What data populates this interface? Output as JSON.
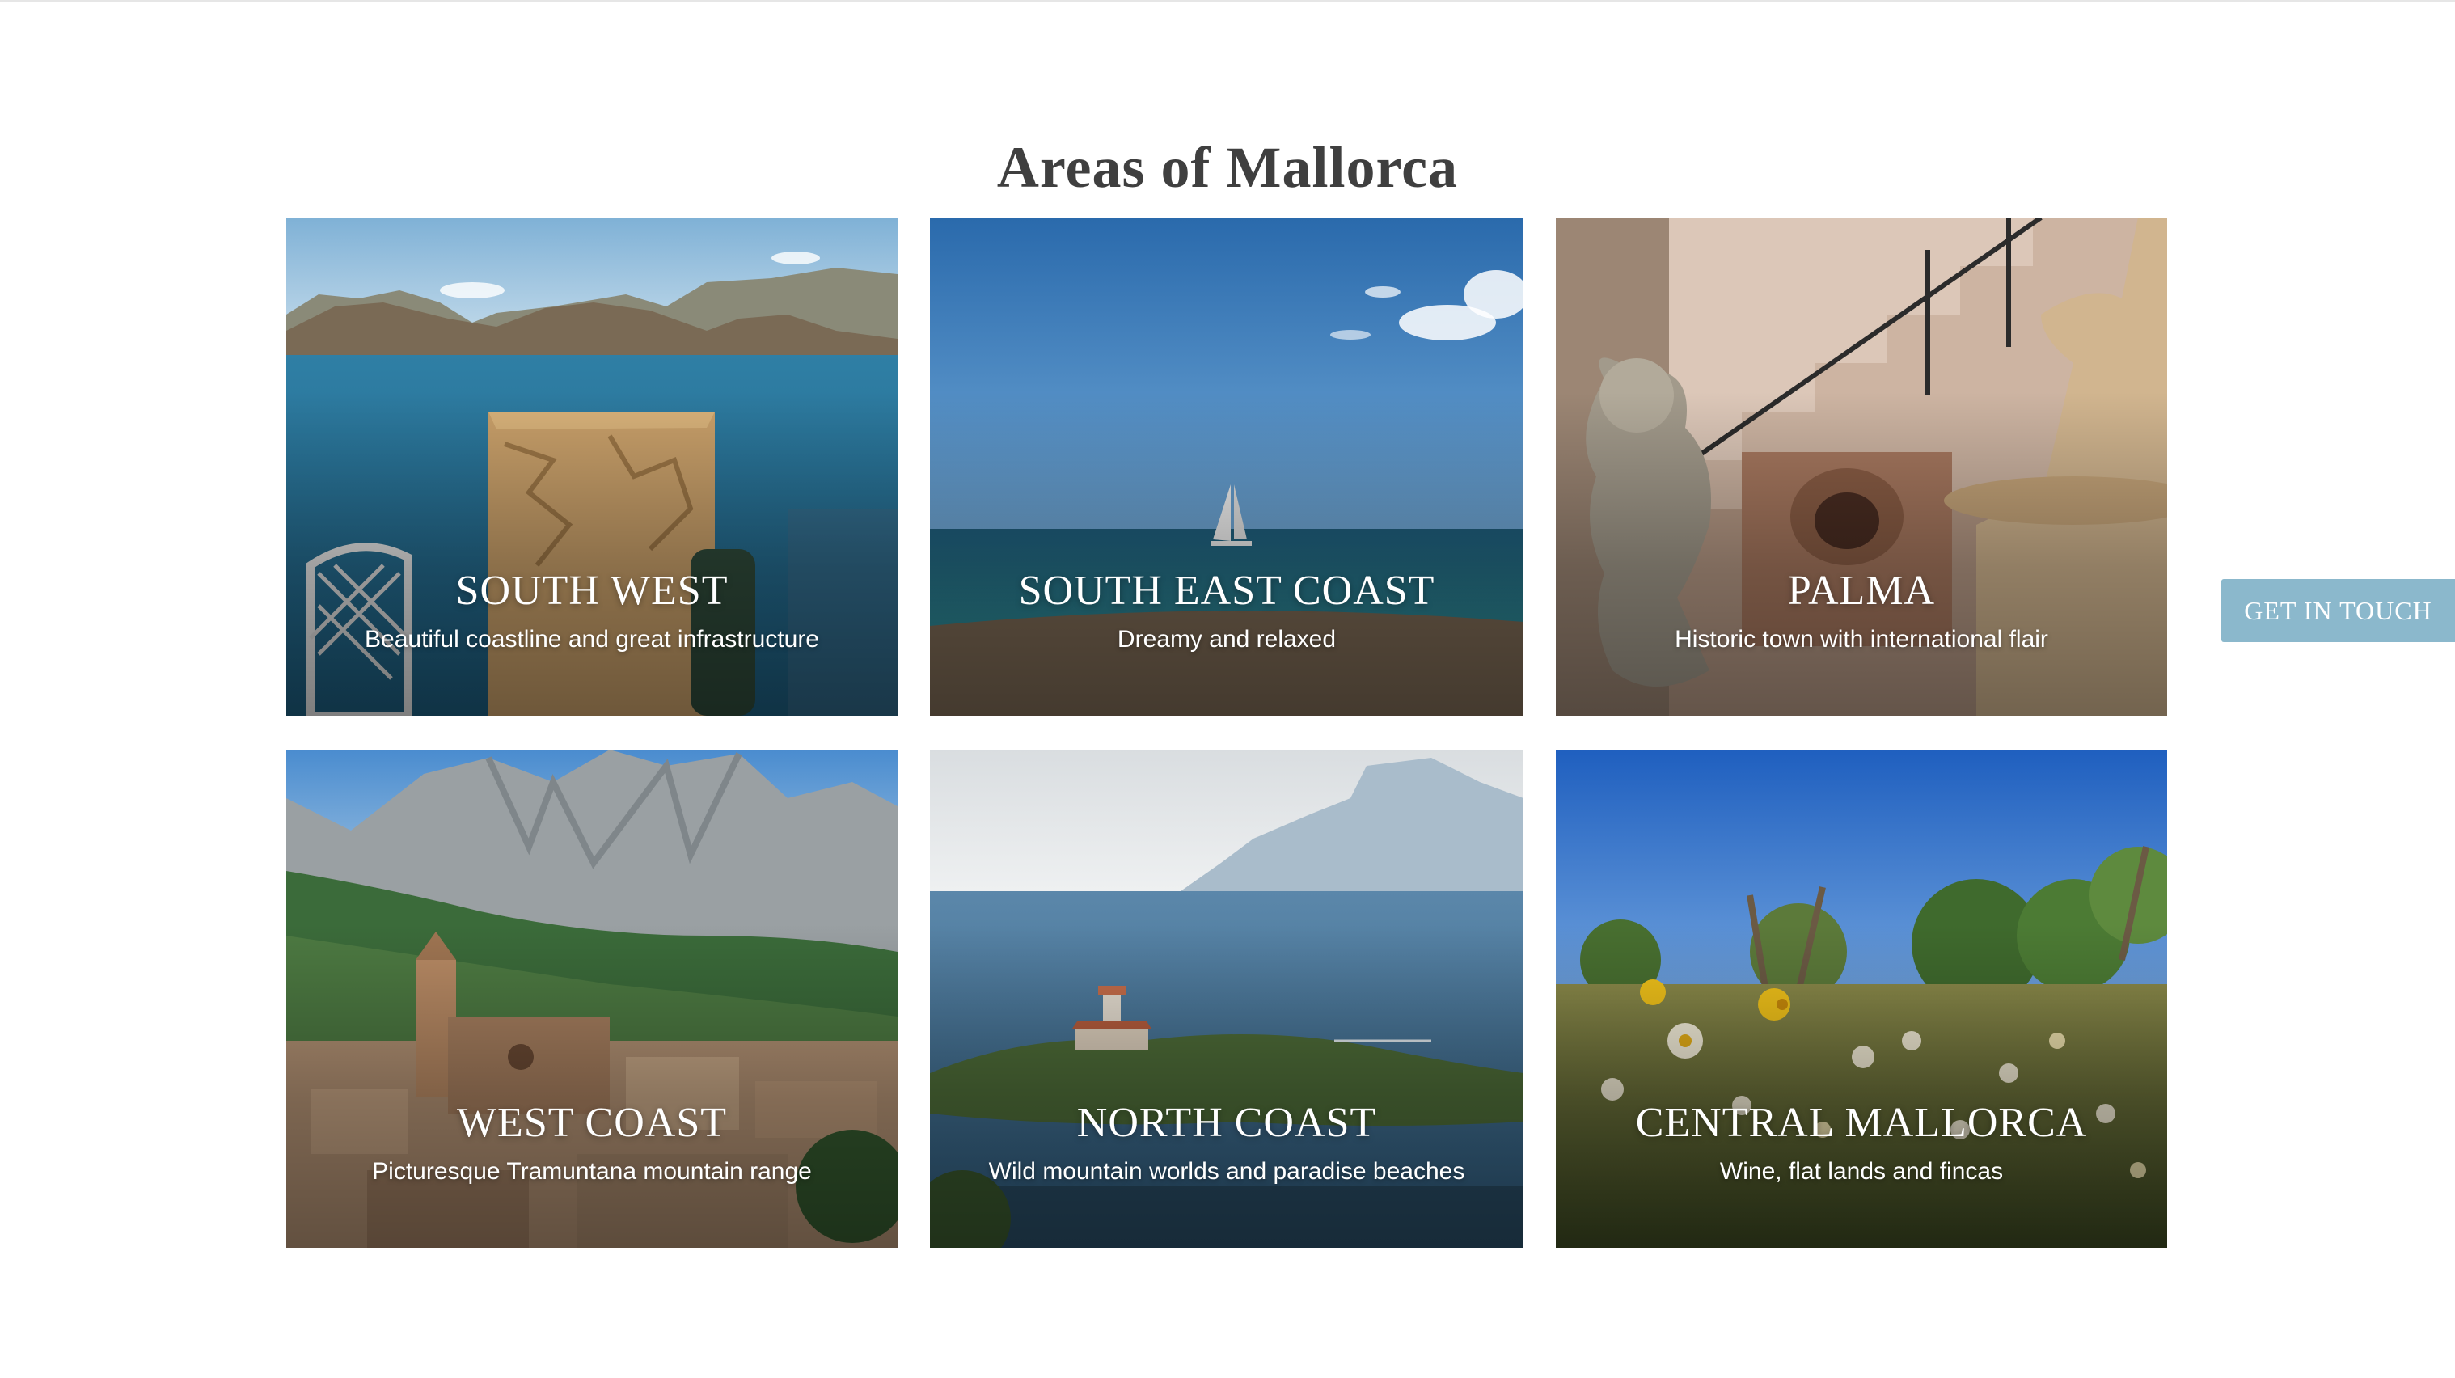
{
  "section": {
    "title": "Areas of Mallorca"
  },
  "areas": [
    {
      "name": "SOUTH WEST",
      "description": "Beautiful coastline and great infrastructure",
      "image": "sea-cliffs-terrace-photo"
    },
    {
      "name": "SOUTH EAST COAST",
      "description": "Dreamy and relaxed",
      "image": "sailboat-sea-photo"
    },
    {
      "name": "PALMA",
      "description": "Historic town with international flair",
      "image": "courtyard-statue-fountain-photo"
    },
    {
      "name": "WEST COAST",
      "description": "Picturesque Tramuntana mountain range",
      "image": "mountain-village-photo"
    },
    {
      "name": "NORTH COAST",
      "description": "Wild mountain worlds and paradise beaches",
      "image": "lighthouse-island-photo"
    },
    {
      "name": "CENTRAL MALLORCA",
      "description": "Wine, flat lands and fincas",
      "image": "wildflower-meadow-photo"
    }
  ],
  "cta": {
    "label": "GET IN TOUCH"
  },
  "colors": {
    "accent": "#8bb8cc",
    "title": "#3f3f3f"
  }
}
